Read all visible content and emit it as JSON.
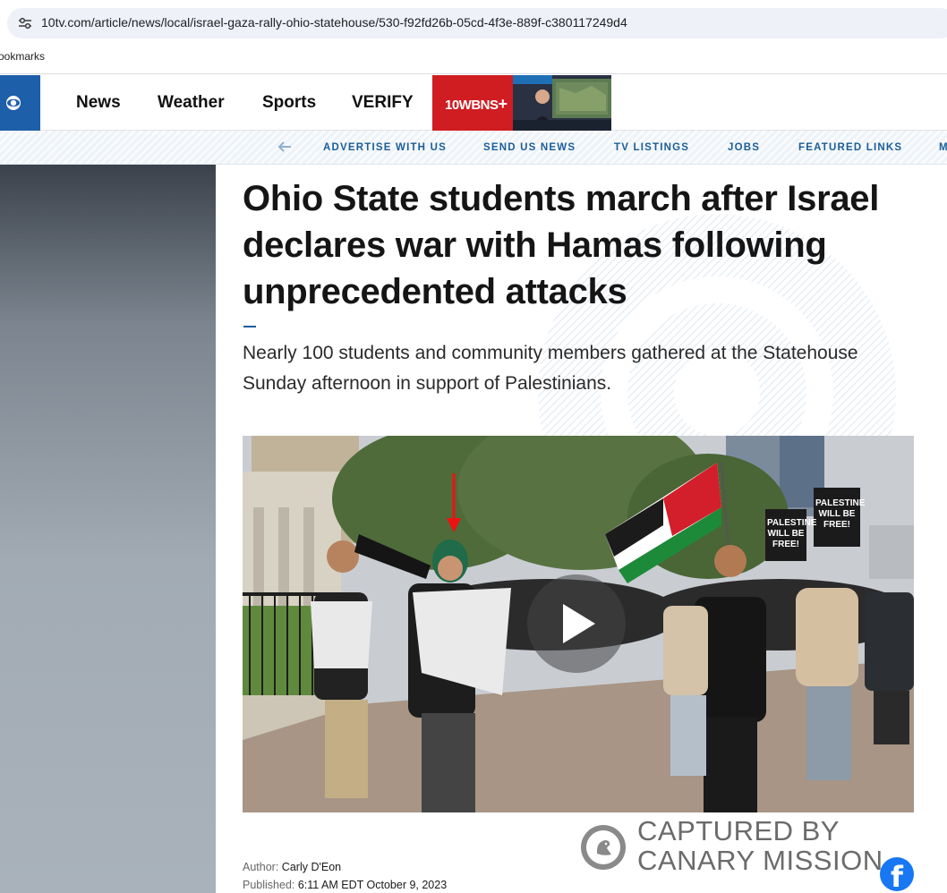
{
  "browser": {
    "url": "10tv.com/article/news/local/israel-gaza-rally-ohio-statehouse/530-f92fd26b-05cd-4f3e-889f-c380117249d4",
    "bookmarks_label": "ookmarks",
    "site_info_icon": "tune-icon"
  },
  "header": {
    "nav": [
      "News",
      "Weather",
      "Sports",
      "VERIFY"
    ],
    "wbns_logo": "10WBNS",
    "wbns_plus": "+",
    "brand_color": "#1d5fa8",
    "wbns_color": "#cf1d22"
  },
  "subnav": {
    "items": [
      "ADVERTISE WITH US",
      "SEND US NEWS",
      "TV LISTINGS",
      "JOBS",
      "FEATURED LINKS",
      "M"
    ],
    "color": "#1b5d97"
  },
  "article": {
    "headline": "Ohio State students march after Israel declares war with Hamas following unprecedented attacks",
    "dek": "Nearly 100 students and community members gathered at the Statehouse Sunday afternoon in support of Palestinians.",
    "media": {
      "sign_1": "PALESTINE WILL BE FREE!",
      "sign_2": "PALESTINE WILL BE FREE!"
    },
    "author_label": "Author:",
    "author_name": "Carly D'Eon",
    "published_label": "Published:",
    "published_value": "6:11 AM EDT October 9, 2023"
  },
  "watermark": {
    "line1": "CAPTURED BY",
    "line2": "CANARY MISSION"
  },
  "share": {
    "facebook_glyph": "f"
  }
}
